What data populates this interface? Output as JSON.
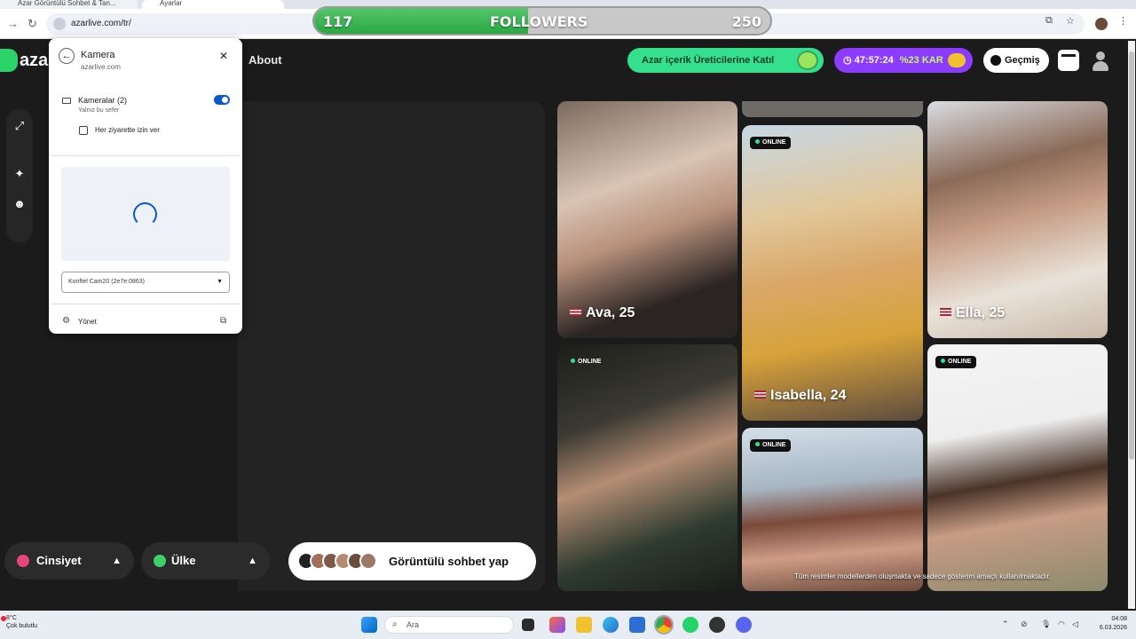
{
  "browser": {
    "tabs": [
      {
        "label": "Azar Görüntülü Sohbet & Tan..."
      },
      {
        "label": "Ayarlar"
      }
    ],
    "url": "azarlive.com/tr/"
  },
  "overlay": {
    "left_count": "117",
    "label": "FOLLOWERS",
    "right_count": "250",
    "progress": 0.468
  },
  "header": {
    "brand": "azar",
    "about": "About",
    "creator_cta": "Azar içerik Üreticilerine Katıl",
    "timer": "47:57:24",
    "discount": "%23 KAR",
    "history": "Geçmiş"
  },
  "permission_popup": {
    "title": "Kamera",
    "site": "azarlive.com",
    "cameras_label": "Kameralar (2)",
    "cameras_sub": "Yalnız bu sefer",
    "allow_each_visit": "Her ziyarette izin ver",
    "camera_select": "Konftel Cam20 (2e7e:0863)",
    "manage": "Yönet"
  },
  "controls": {
    "gender": "Cinsiyet",
    "country": "Ülke",
    "start_video_chat": "Görüntülü sohbet yap"
  },
  "cards": [
    {
      "name": "Ava, 25",
      "online": false
    },
    {
      "name": "Isabella, 24",
      "online": true
    },
    {
      "name": "Ella, 25",
      "online": false
    },
    {
      "name": "",
      "online": true
    },
    {
      "name": "",
      "online": true
    },
    {
      "name": "",
      "online": true
    }
  ],
  "online_label": "ONLINE",
  "disclaimer": "Tüm resimler modellerden oluşmakta ve sadece gösterim amaçlı kullanılmaktadır.",
  "taskbar": {
    "temperature": "8°C",
    "weather": "Çok bulutlu",
    "search_placeholder": "Ara",
    "time": "04:08",
    "date": "6.03.2026"
  },
  "colors": {
    "brand_green": "#34e08d",
    "purple": "#8c3cff",
    "chrome_blue": "#0b57d0"
  }
}
